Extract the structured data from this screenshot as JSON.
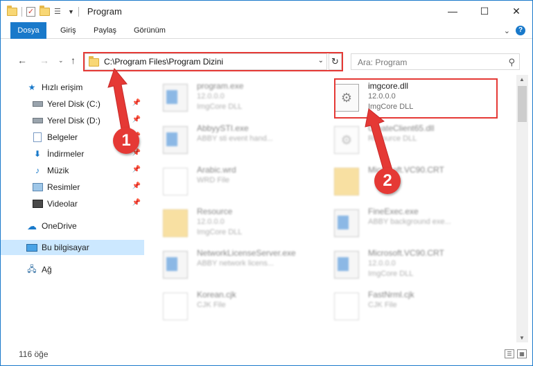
{
  "window": {
    "title": "Program",
    "controls": [
      "minimize-icon",
      "maximize-icon",
      "close-icon"
    ]
  },
  "ribbon": {
    "tabs": [
      "Dosya",
      "Giriş",
      "Paylaş",
      "Görünüm"
    ],
    "accent": "#1979ca"
  },
  "nav": {
    "address": "C:\\Program Files\\Program Dizini",
    "search_placeholder": "Ara: Program"
  },
  "sidebar": {
    "items": [
      {
        "label": "Hızlı erişim",
        "icon": "star-icon",
        "pinned": false
      },
      {
        "label": "Yerel Disk (C:)",
        "icon": "drive-icon",
        "pinned": true
      },
      {
        "label": "Yerel Disk (D:)",
        "icon": "drive-icon",
        "pinned": true
      },
      {
        "label": "Belgeler",
        "icon": "documents-icon",
        "pinned": true
      },
      {
        "label": "İndirmeler",
        "icon": "download-icon",
        "pinned": true
      },
      {
        "label": "Müzik",
        "icon": "music-icon",
        "pinned": true
      },
      {
        "label": "Resimler",
        "icon": "pictures-icon",
        "pinned": true
      },
      {
        "label": "Videolar",
        "icon": "videos-icon",
        "pinned": true
      },
      {
        "label": "OneDrive",
        "icon": "cloud-icon",
        "pinned": false
      },
      {
        "label": "Bu bilgisayar",
        "icon": "computer-icon",
        "pinned": false
      },
      {
        "label": "Ağ",
        "icon": "network-icon",
        "pinned": false
      }
    ],
    "selected": "Bu bilgisayar"
  },
  "files": [
    {
      "name": "program.exe",
      "line2": "12.0.0.0",
      "line3": "ImgCore DLL",
      "icon": "app-icon"
    },
    {
      "name": "imgcore.dll",
      "line2": "12.0.0.0",
      "line3": "ImgCore DLL",
      "icon": "dll-gear-icon",
      "highlighted": true
    },
    {
      "name": "AbbyySTI.exe",
      "line2": "ABBY sti event hand...",
      "line3": "",
      "icon": "app-icon"
    },
    {
      "name": "CreateClient65.dll",
      "line2": "Resource DLL",
      "line3": "",
      "icon": "dll-gear-icon"
    },
    {
      "name": "Arabic.wrd",
      "line2": "WRD File",
      "line3": "",
      "icon": "file-icon"
    },
    {
      "name": "Microsoft.VC90.CRT",
      "line2": "",
      "line3": "",
      "icon": "folder-icon"
    },
    {
      "name": "Resource",
      "line2": "12.0.0.0",
      "line3": "ImgCore DLL",
      "icon": "folder-icon"
    },
    {
      "name": "FineExec.exe",
      "line2": "ABBY background exe...",
      "line3": "",
      "icon": "app-icon"
    },
    {
      "name": "NetworkLicenseServer.exe",
      "line2": "ABBY network licens...",
      "line3": "",
      "icon": "app-icon"
    },
    {
      "name": "Microsoft.VC90.CRT",
      "line2": "12.0.0.0",
      "line3": "ImgCore DLL",
      "icon": "app-icon"
    },
    {
      "name": "Korean.cjk",
      "line2": "CJK File",
      "line3": "",
      "icon": "file-icon"
    },
    {
      "name": "FastNrml.cjk",
      "line2": "CJK File",
      "line3": "",
      "icon": "file-icon"
    }
  ],
  "status": {
    "count": "116 öğe"
  },
  "annotations": {
    "badge1": "1",
    "badge2": "2",
    "color": "#e53935"
  }
}
